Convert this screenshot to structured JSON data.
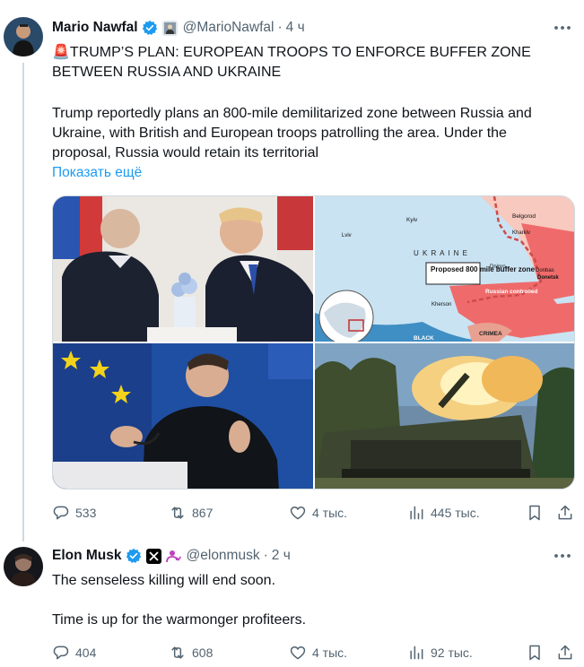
{
  "tweets": [
    {
      "name": "Mario Nawfal",
      "handle": "@MarioNawfal",
      "dot": "·",
      "time": "4 ч",
      "title": "🚨TRUMP’S PLAN: EUROPEAN TROOPS TO ENFORCE BUFFER ZONE BETWEEN RUSSIA AND UKRAINE",
      "body": "Trump reportedly plans an 800-mile demilitarized zone between Russia and Ukraine, with British and European troops patrolling the area. Under the proposal, Russia would retain its territorial",
      "show_more": "Показать ещё",
      "map": {
        "cities": [
          "Kyiv",
          "Lviv",
          "Belgorod",
          "Kharkiv",
          "Dnipro",
          "Kherson",
          "Donetsk",
          "Donbas"
        ],
        "country": "U K R A I N E",
        "callout": "Proposed 800 mile buffer zone",
        "russian": "Russian controlled",
        "crimea": "CRIMEA",
        "sea": "BLACK"
      },
      "stats": {
        "replies": "533",
        "reposts": "867",
        "likes": "4 тыс.",
        "views": "445 тыс."
      }
    },
    {
      "name": "Elon Musk",
      "handle": "@elonmusk",
      "dot": "·",
      "time": "2 ч",
      "line1": "The senseless killing will end soon.",
      "line2": "Time is up for the warmonger profiteers.",
      "stats": {
        "replies": "404",
        "reposts": "608",
        "likes": "4 тыс.",
        "views": "92 тыс."
      }
    }
  ],
  "colors": {
    "accent": "#1d9bf0",
    "muted": "#536471",
    "verified": "#1d9bf0",
    "affiliate_purple": "#c040c0"
  },
  "icons": [
    "verified-badge-icon",
    "reply-icon",
    "repost-icon",
    "like-icon",
    "views-icon",
    "bookmark-icon",
    "share-icon",
    "more-icon"
  ]
}
